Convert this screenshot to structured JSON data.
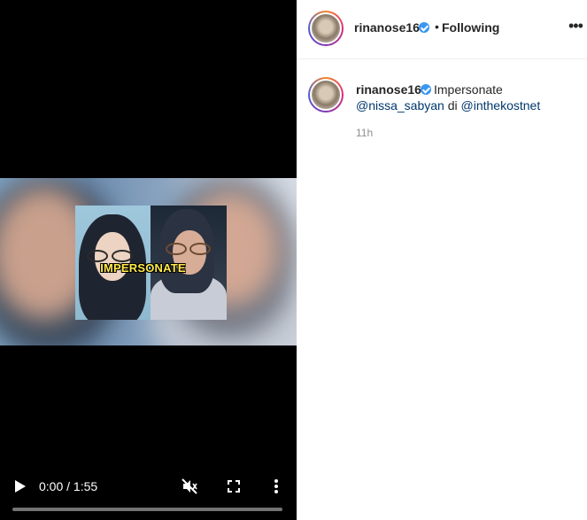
{
  "video": {
    "overlay_text": "IMPERSONATE",
    "time_display": "0:00 / 1:55",
    "progress_fraction": 0,
    "icons": {
      "play": "play-icon",
      "mute": "volume-muted-icon",
      "fullscreen": "fullscreen-icon",
      "more": "more-vertical-icon"
    }
  },
  "header": {
    "username": "rinanose16",
    "separator": "•",
    "follow_status": "Following",
    "more_icon": "more-horizontal-icon",
    "verified_icon": "verified-badge-icon"
  },
  "comment": {
    "username": "rinanose16",
    "caption_text": "Impersonate",
    "mention1": "@nissa_sabyan",
    "connector": " di ",
    "mention2": "@inthekostnet",
    "time_ago": "11h"
  },
  "colors": {
    "verified": "#3897f0",
    "mention": "#00376b",
    "overlay_text": "#ffe94a"
  }
}
